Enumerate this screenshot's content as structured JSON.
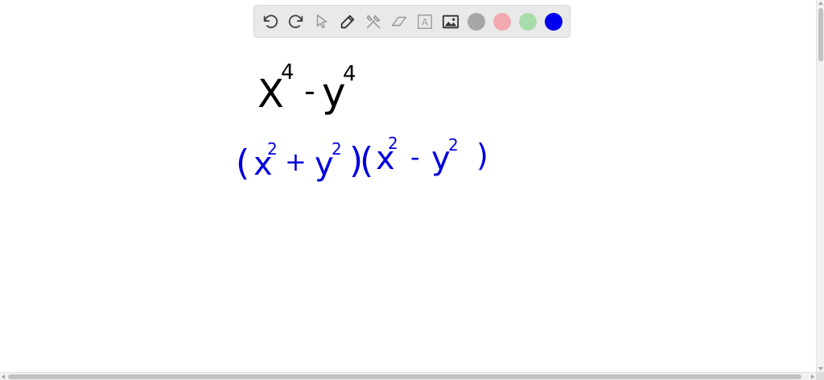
{
  "toolbar": {
    "tools": [
      {
        "icon": "undo-icon"
      },
      {
        "icon": "redo-icon"
      },
      {
        "icon": "pointer-icon"
      },
      {
        "icon": "pen-icon"
      },
      {
        "icon": "tools-icon"
      },
      {
        "icon": "eraser-icon"
      },
      {
        "icon": "text-icon",
        "glyph": "A"
      },
      {
        "icon": "image-icon"
      }
    ],
    "colors": [
      {
        "name": "gray",
        "hex": "#a6a6a6"
      },
      {
        "name": "pink",
        "hex": "#f2a9b0"
      },
      {
        "name": "green",
        "hex": "#a8dcab"
      },
      {
        "name": "blue",
        "hex": "#0000ee"
      }
    ]
  },
  "canvas": {
    "line1": {
      "base1": "X",
      "exp1": "4",
      "op": "-",
      "base2": "y",
      "exp2": "4",
      "ink": "#000000"
    },
    "line2": {
      "open1": "(",
      "x": "x",
      "x_exp": "2",
      "plus": "+",
      "y": "y",
      "y_exp": "2",
      "close1": ")",
      "open2": "(",
      "x2": "x",
      "x2_exp": "2",
      "minus": "-",
      "y2": "y",
      "y2_exp": "2",
      "close2": ")",
      "ink": "#0000dd"
    }
  }
}
